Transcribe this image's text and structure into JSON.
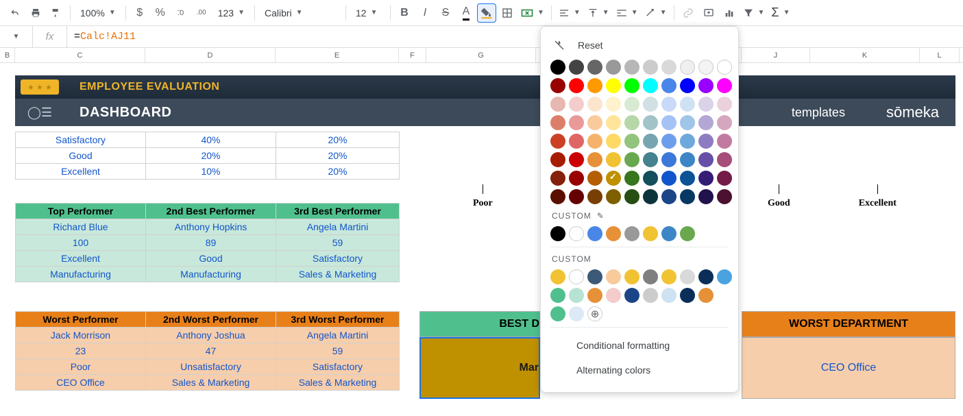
{
  "toolbar": {
    "zoom": "100%",
    "font": "Calibri",
    "fontsize": "12",
    "currency": "$",
    "percent": "%",
    "dec_dec": ".0",
    "dec_inc": ".00",
    "numfmt": "123"
  },
  "formula": {
    "eq": "=",
    "ref": "Calc!AJ11"
  },
  "columns": [
    "B",
    "C",
    "D",
    "E",
    "F",
    "G",
    "J",
    "K",
    "L"
  ],
  "header": {
    "stars": "★ ★ ★",
    "title1": "EMPLOYEE EVALUATION",
    "title2": "DASHBOARD",
    "templates": "templates",
    "brand": "sōmeka"
  },
  "ratings": [
    {
      "label": "Satisfactory",
      "c1": "40%",
      "c2": "20%"
    },
    {
      "label": "Good",
      "c1": "20%",
      "c2": "20%"
    },
    {
      "label": "Excellent",
      "c1": "10%",
      "c2": "20%"
    }
  ],
  "top": {
    "h": [
      "Top Performer",
      "2nd Best Performer",
      "3rd Best Performer"
    ],
    "r": [
      [
        "Richard Blue",
        "Anthony Hopkins",
        "Angela Martini"
      ],
      [
        "100",
        "89",
        "59"
      ],
      [
        "Excellent",
        "Good",
        "Satisfactory"
      ],
      [
        "Manufacturing",
        "Manufacturing",
        "Sales & Marketing"
      ]
    ]
  },
  "worst": {
    "h": [
      "Worst Performer",
      "2nd Worst Performer",
      "3rd Worst Performer"
    ],
    "r": [
      [
        "Jack Morrison",
        "Anthony Joshua",
        "Angela Martini"
      ],
      [
        "23",
        "47",
        "59"
      ],
      [
        "Poor",
        "Unsatisfactory",
        "Satisfactory"
      ],
      [
        "CEO Office",
        "Sales & Marketing",
        "Sales & Marketing"
      ]
    ]
  },
  "axis": [
    "Poor",
    "Good",
    "Excellent"
  ],
  "dept": {
    "best_h": "BEST D",
    "best_v_partial": "Mar",
    "worst_h": "WORST DEPARTMENT",
    "worst_v": "CEO Office"
  },
  "popup": {
    "reset": "Reset",
    "custom": "CUSTOM",
    "cond": "Conditional formatting",
    "alt": "Alternating colors",
    "std_colors": [
      [
        "#000000",
        "#434343",
        "#666666",
        "#999999",
        "#b7b7b7",
        "#cccccc",
        "#d9d9d9",
        "#efefef",
        "#f3f3f3",
        "#ffffff"
      ],
      [
        "#980000",
        "#ff0000",
        "#ff9900",
        "#ffff00",
        "#00ff00",
        "#00ffff",
        "#4a86e8",
        "#0000ff",
        "#9900ff",
        "#ff00ff"
      ],
      [
        "#e6b8af",
        "#f4cccc",
        "#fce5cd",
        "#fff2cc",
        "#d9ead3",
        "#d0e0e3",
        "#c9daf8",
        "#cfe2f3",
        "#d9d2e9",
        "#ead1dc"
      ],
      [
        "#dd7e6b",
        "#ea9999",
        "#f9cb9c",
        "#ffe599",
        "#b6d7a8",
        "#a2c4c9",
        "#a4c2f4",
        "#9fc5e8",
        "#b4a7d6",
        "#d5a6bd"
      ],
      [
        "#cc4125",
        "#e06666",
        "#f6b26b",
        "#ffd966",
        "#93c47d",
        "#76a5af",
        "#6d9eeb",
        "#6fa8dc",
        "#8e7cc3",
        "#c27ba0"
      ],
      [
        "#a61c00",
        "#cc0000",
        "#e69138",
        "#f1c232",
        "#6aa84f",
        "#45818e",
        "#3c78d8",
        "#3d85c6",
        "#674ea7",
        "#a64d79"
      ],
      [
        "#85200c",
        "#990000",
        "#b45f06",
        "#bf9000",
        "#38761d",
        "#134f5c",
        "#1155cc",
        "#0b5394",
        "#351c75",
        "#741b47"
      ],
      [
        "#5b0f00",
        "#660000",
        "#783f04",
        "#7f6000",
        "#274e13",
        "#0c343d",
        "#1c4587",
        "#073763",
        "#20124d",
        "#4c1130"
      ]
    ],
    "checked": "#bf9000",
    "custom_row1": [
      "#000000",
      "#ffffff",
      "#4a86e8",
      "#e69138",
      "#999999",
      "#f1c232",
      "#3d85c6",
      "#6aa84f"
    ],
    "custom_row2": [
      "#f1c232",
      "#ffffff",
      "#3c5a78",
      "#f9cb9c",
      "#f1c232",
      "#7f7f7f",
      "#f1c232",
      "#d9d9d9",
      "#0b2e59",
      "#4aa3df"
    ],
    "custom_row3": [
      "#4fc08d",
      "#b6e3d4",
      "#e69138",
      "#f4cccc",
      "#1c4587",
      "#cccccc",
      "#cfe2f3",
      "#0b2e59",
      "#e69138"
    ],
    "custom_row4": [
      "#4fc08d",
      "#dce9f7"
    ]
  }
}
